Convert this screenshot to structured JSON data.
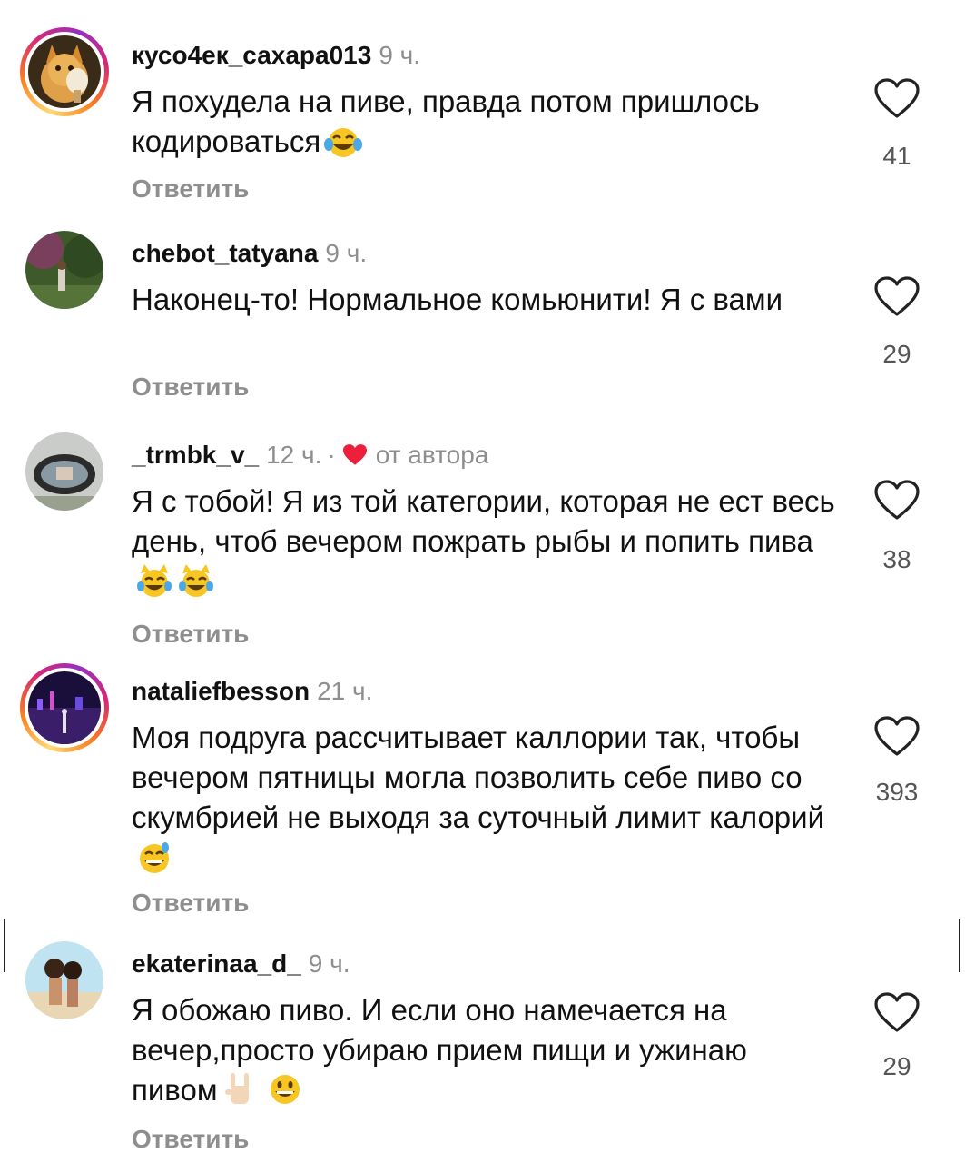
{
  "comments": [
    {
      "username": "кусо4ек_сахара013",
      "time": "9 ч.",
      "text": "Я похудела на пиве, правда потом пришлось кодироваться",
      "emoji": "😂",
      "likes": "41",
      "reply": "Ответить",
      "story_ring": true,
      "avatar_icon": "cat-avatar"
    },
    {
      "username": "chebot_tatyana",
      "time": "9 ч.",
      "text": "Наконец-то! Нормальное комьюнити! Я с вами",
      "emoji": "",
      "likes": "29",
      "reply": "Ответить",
      "story_ring": false,
      "avatar_icon": "garden-photo-avatar"
    },
    {
      "username": "_trmbk_v_",
      "time": "12 ч.",
      "separator": "·",
      "author_label": "от автора",
      "author_heart_color": "#ed1f3b",
      "text": "Я с тобой! Я из той категории, которая не ест весь день, чтоб вечером пожрать рыбы и попить пива",
      "emoji": "😹 😹",
      "likes": "38",
      "reply": "Ответить",
      "story_ring": false,
      "avatar_icon": "car-mirror-avatar"
    },
    {
      "username": "nataliefbesson",
      "time": "21 ч.",
      "text": "Моя подруга рассчитывает каллории так, чтобы вечером пятницы могла позволить себе пиво со скумбрией не выходя за суточный лимит калорий",
      "emoji": "😅",
      "likes": "393",
      "reply": "Ответить",
      "story_ring": true,
      "avatar_icon": "night-city-avatar"
    },
    {
      "username": "ekaterinaa_d_",
      "time": "9 ч.",
      "text": "Я обожаю пиво. И если оно намечается на вечер,просто убираю прием пищи и ужинаю пивом",
      "emoji": "🤘🏻 😃",
      "likes": "29",
      "reply": "Ответить",
      "story_ring": false,
      "avatar_icon": "beach-photo-avatar"
    }
  ],
  "colors": {
    "text": "#111111",
    "muted": "#8e8e8e",
    "heart_outline": "#222222",
    "author_heart": "#ed1f3b"
  }
}
